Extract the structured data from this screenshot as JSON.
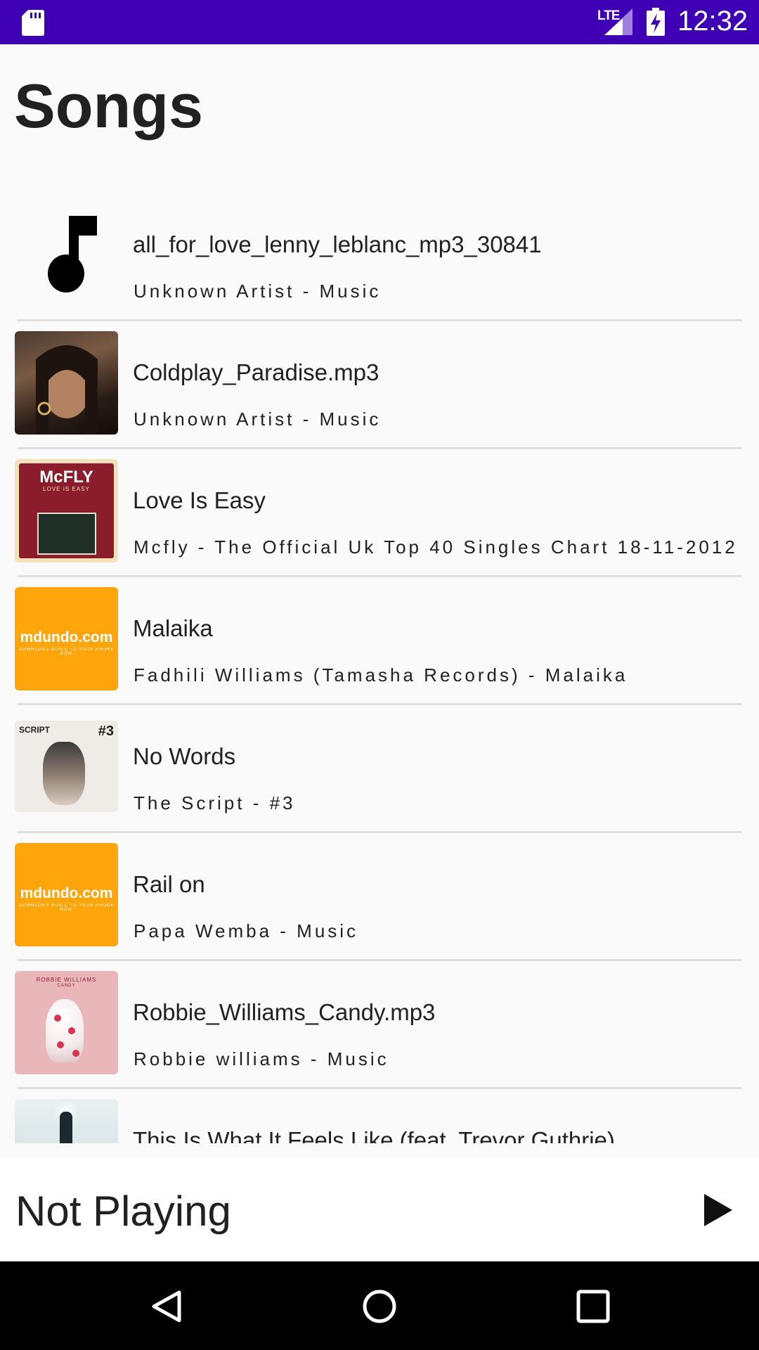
{
  "status_bar": {
    "time": "12:32",
    "network_label": "LTE",
    "icons": [
      "sd-card-icon",
      "signal-icon",
      "battery-charging-icon"
    ]
  },
  "page": {
    "title": "Songs"
  },
  "songs": [
    {
      "title": "all_for_love_lenny_leblanc_mp3_30841",
      "subtitle": "Unknown Artist - Music",
      "art": "music-note-icon"
    },
    {
      "title": "Coldplay_Paradise.mp3",
      "subtitle": "Unknown Artist - Music",
      "art": "album-art-photo"
    },
    {
      "title": "Love Is Easy",
      "subtitle": "Mcfly - The Official Uk Top 40 Singles Chart 18-11-2012",
      "art": "album-art-mcfly",
      "art_text": "McFLY",
      "art_subtext": "LOVE IS EASY"
    },
    {
      "title": "Malaika",
      "subtitle": "Fadhili Williams (Tamasha Records) - Malaika",
      "art": "album-art-mdundo",
      "art_text": "mdundo.com",
      "art_subtext": "DOWNLOAD MUSIC TO YOUR PHONE NOW"
    },
    {
      "title": "No Words",
      "subtitle": "The Script - #3",
      "art": "album-art-script",
      "art_text": "SCRIPT",
      "art_subtext": "#3"
    },
    {
      "title": "Rail on",
      "subtitle": "Papa Wemba - Music",
      "art": "album-art-mdundo",
      "art_text": "mdundo.com",
      "art_subtext": "DOWNLOAD MUSIC TO YOUR PHONE NOW"
    },
    {
      "title": "Robbie_Williams_Candy.mp3",
      "subtitle": "Robbie williams - Music",
      "art": "album-art-robbie",
      "art_text": "ROBBIE WILLIAMS",
      "art_subtext": "CANDY"
    },
    {
      "title": "This Is What It Feels Like (feat. Trevor Guthrie)",
      "subtitle": "",
      "art": "album-art-armin"
    }
  ],
  "player": {
    "status": "Not Playing",
    "play_icon": "play-icon"
  },
  "nav_bar": {
    "icons": [
      "back-icon",
      "home-icon",
      "recents-icon"
    ]
  },
  "colors": {
    "status_bar": "#3f00b5",
    "mdundo": "#ffa50c",
    "background": "#fafafa"
  }
}
